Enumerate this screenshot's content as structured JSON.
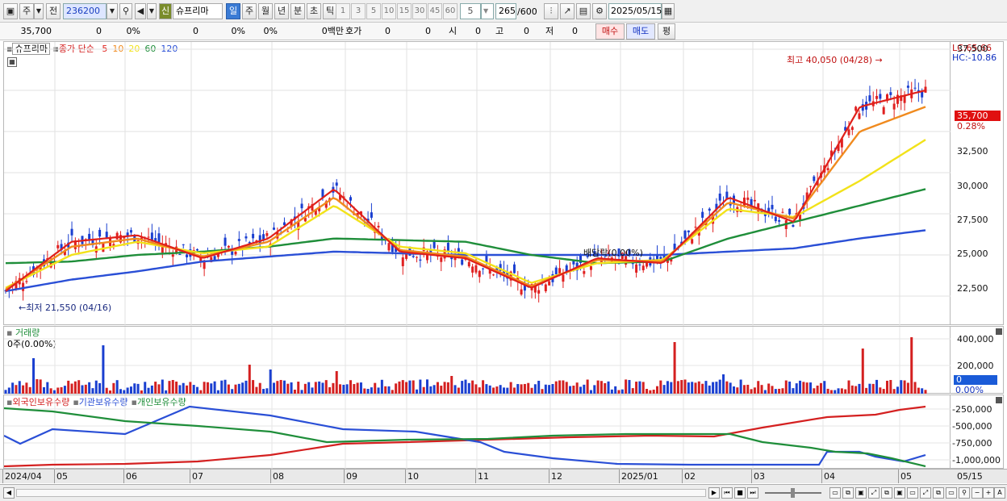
{
  "toolbar": {
    "type_label": "주",
    "prev_label": "전",
    "code": "236200",
    "stock_badge": "신",
    "stock_name": "슈프리마",
    "periods": [
      "일",
      "주",
      "월",
      "년",
      "분",
      "초",
      "틱"
    ],
    "selected_period": "일",
    "intervals": [
      "1",
      "3",
      "5",
      "10",
      "15",
      "30",
      "45",
      "60"
    ],
    "interval_value": "5",
    "count_value": "265",
    "count_total": "/600",
    "date": "2025/05/15"
  },
  "info_bar": {
    "price": "35,700",
    "change": "0",
    "change_pct": "0%",
    "volume": "0",
    "volume_pct": "0%",
    "v2": "0%",
    "amount": "0백만",
    "quote_label": "호가",
    "q1": "0",
    "q2": "0",
    "open_label": "시",
    "open": "0",
    "high_label": "고",
    "high": "0",
    "low_label": "저",
    "low": "0",
    "buy": "매수",
    "sell": "매도",
    "avg": "평"
  },
  "price_panel": {
    "title": "슈프리마",
    "ma_label": "종가 단순",
    "ma_periods": [
      "5",
      "10",
      "20",
      "60",
      "120"
    ],
    "ma_colors": [
      "#e0201a",
      "#f08a1e",
      "#f2e21a",
      "#1f8e3a",
      "#2a4fd6"
    ],
    "high_annotation": "최고 40,050 (04/28)",
    "low_annotation": "최저 21,550 (04/16)",
    "dividend_annotation": "배당락(0.00%)",
    "lc": "LC:65.66",
    "hc": "HC:-10.86",
    "current_price": "35,700",
    "current_pct": "0.28%",
    "y_ticks": [
      "37,500",
      "35,000",
      "32,500",
      "30,000",
      "27,500",
      "25,000",
      "22,500"
    ]
  },
  "volume_panel": {
    "title": "거래량",
    "sub": "0주(0.00%)",
    "y_ticks": [
      "400,000",
      "200,000"
    ],
    "current": "0",
    "current_pct": "0.00%"
  },
  "holder_panel": {
    "legend": [
      "외국인보유수량",
      "기관보유수량",
      "개인보유수량"
    ],
    "legend_colors": [
      "#d42020",
      "#2a4fd6",
      "#1f8e3a"
    ],
    "y_ticks": [
      "-250,000",
      "-500,000",
      "-750,000",
      "-1,000,000"
    ]
  },
  "x_labels": [
    "2024/04",
    "05",
    "06",
    "07",
    "08",
    "09",
    "10",
    "11",
    "12",
    "2025/01",
    "02",
    "03",
    "04",
    "05"
  ],
  "x_right_label": "05/15",
  "chart_data": {
    "type": "line",
    "title": "슈프리마",
    "y_ticks": [
      22500,
      25000,
      27500,
      30000,
      32500,
      35000,
      37500
    ],
    "ylim": [
      21000,
      40500
    ],
    "x": [
      "2024/04",
      "05",
      "06",
      "07",
      "08",
      "09",
      "10",
      "11",
      "12",
      "2025/01",
      "02",
      "03",
      "04",
      "05",
      "05/15"
    ],
    "series": [
      {
        "name": "5",
        "values": [
          22800,
          25800,
          26200,
          24800,
          26000,
          29000,
          25200,
          24800,
          23000,
          24800,
          24500,
          28500,
          27000,
          34000,
          35000
        ]
      },
      {
        "name": "10",
        "values": [
          22900,
          25500,
          26000,
          24900,
          25800,
          28500,
          25300,
          24900,
          23100,
          24700,
          24600,
          28200,
          27200,
          32500,
          34000
        ]
      },
      {
        "name": "20",
        "values": [
          23000,
          25000,
          25800,
          25100,
          25500,
          28000,
          25500,
          25100,
          23300,
          24500,
          24700,
          27800,
          27300,
          29500,
          32000
        ]
      },
      {
        "name": "60",
        "values": [
          24500,
          24600,
          25000,
          25200,
          25500,
          26000,
          25900,
          25800,
          25000,
          24500,
          24600,
          26000,
          27000,
          28000,
          29000
        ]
      },
      {
        "name": "120",
        "values": [
          22800,
          23500,
          24000,
          24600,
          24900,
          25200,
          25100,
          25000,
          25000,
          25000,
          25000,
          25200,
          25400,
          26000,
          26500
        ]
      }
    ]
  }
}
